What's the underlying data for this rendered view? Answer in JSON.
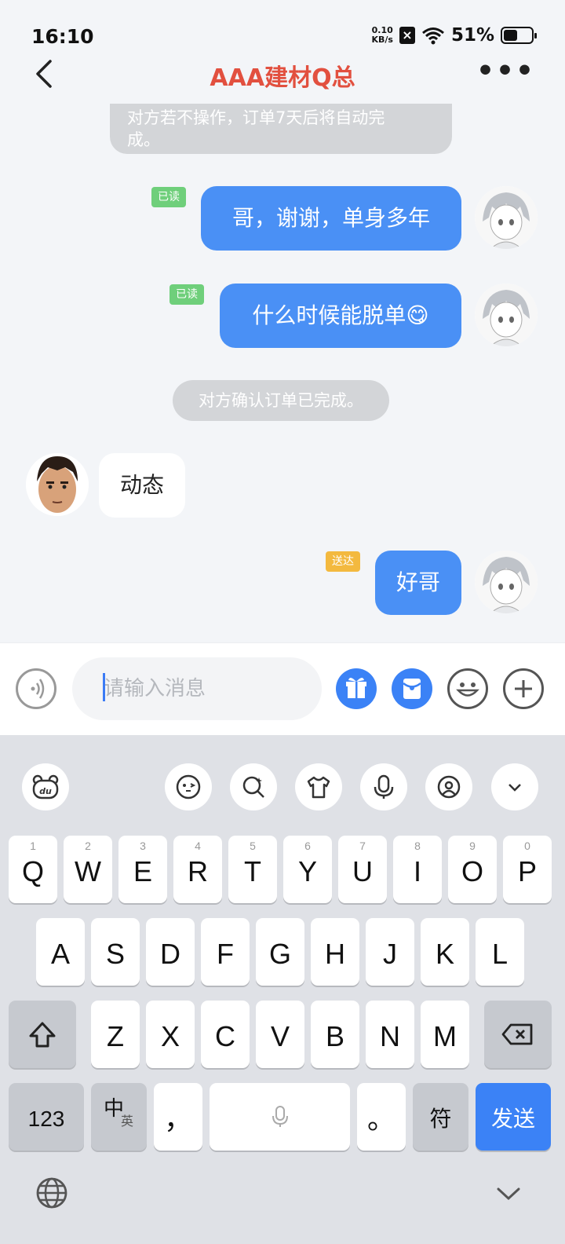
{
  "status": {
    "time": "16:10",
    "net_speed_top": "0.10",
    "net_speed_bottom": "KB/s",
    "battery": "51%"
  },
  "header": {
    "title": "AAA建材Q总"
  },
  "chat": {
    "system_top_line1": "对方若不操作，订单7天后将自动完",
    "system_top_line2": "成。",
    "msg1": {
      "text": "哥，谢谢，单身多年",
      "tag": "已读"
    },
    "msg2": {
      "text": "什么时候能脱单😋",
      "tag": "已读"
    },
    "system_mid": "对方确认订单已完成。",
    "msg3": {
      "text": "动态"
    },
    "msg4": {
      "text": "好哥",
      "tag": "送达"
    }
  },
  "input": {
    "placeholder": "请输入消息"
  },
  "keyboard": {
    "row1": [
      {
        "k": "Q",
        "n": "1"
      },
      {
        "k": "W",
        "n": "2"
      },
      {
        "k": "E",
        "n": "3"
      },
      {
        "k": "R",
        "n": "4"
      },
      {
        "k": "T",
        "n": "5"
      },
      {
        "k": "Y",
        "n": "6"
      },
      {
        "k": "U",
        "n": "7"
      },
      {
        "k": "I",
        "n": "8"
      },
      {
        "k": "O",
        "n": "9"
      },
      {
        "k": "P",
        "n": "0"
      }
    ],
    "row2": [
      "A",
      "S",
      "D",
      "F",
      "G",
      "H",
      "J",
      "K",
      "L"
    ],
    "row3": [
      "Z",
      "X",
      "C",
      "V",
      "B",
      "N",
      "M"
    ],
    "num_key": "123",
    "lang_main": "中",
    "lang_sub": "英",
    "comma": "，",
    "period": "。",
    "symbol_key": "符",
    "send_key": "发送"
  },
  "colors": {
    "accent": "#4a90f5",
    "title": "#e2503f",
    "read_tag": "#6fcf7b",
    "sent_tag": "#f3b93f"
  }
}
